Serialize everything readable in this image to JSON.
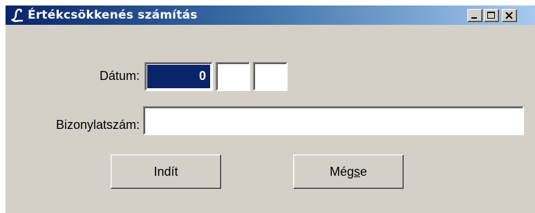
{
  "window": {
    "title": "Értékcsökkenés számítás"
  },
  "form": {
    "date_label": "Dátum:",
    "date_part_1": "0",
    "date_part_2": "",
    "date_part_3": "",
    "document_number_label": "Bizonylatszám:",
    "document_number_value": ""
  },
  "buttons": {
    "start_label": "Indít",
    "cancel_label_pre": "Még",
    "cancel_label_accel": "s",
    "cancel_label_post": "e"
  },
  "icons": {
    "app": "script-l-icon",
    "minimize": "minimize-icon",
    "maximize": "maximize-icon",
    "close": "close-icon"
  },
  "colors": {
    "titlebar_start": "#0a246a",
    "titlebar_end": "#a6caf0",
    "window_bg": "#d4d0c8",
    "selection_bg": "#0a246a"
  }
}
